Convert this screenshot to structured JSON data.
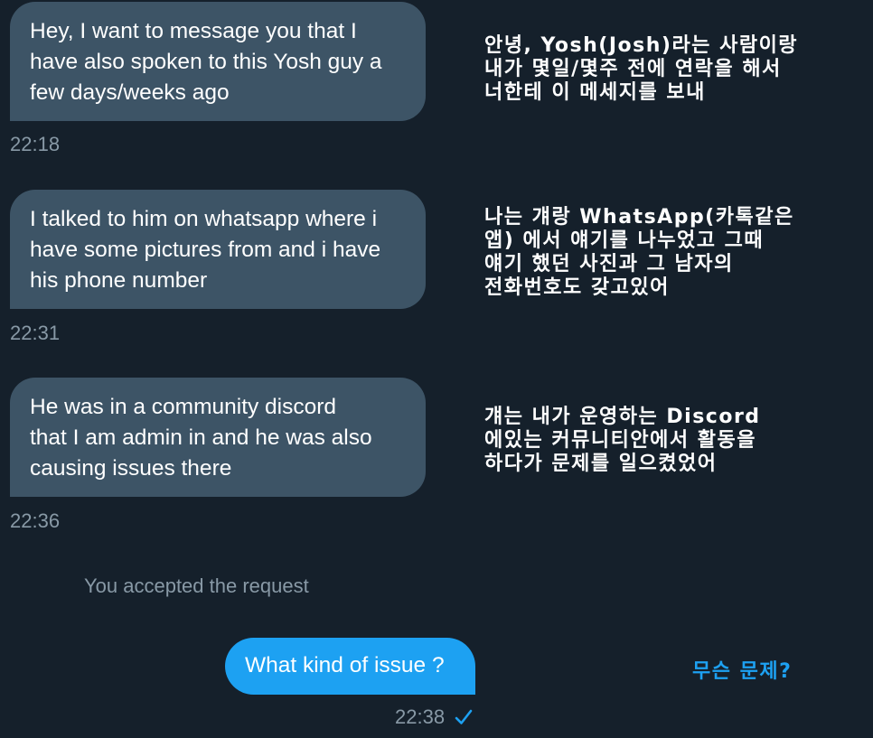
{
  "conversation": {
    "received": [
      {
        "text": "Hey, I want to message you that I\nhave also spoken to this Yosh guy a\nfew days/weeks ago",
        "time": "22:18",
        "translation": "안녕, Yosh(Josh)라는 사람이랑\n내가 몇일/몇주 전에 연락을 해서\n너한테 이 메세지를 보내"
      },
      {
        "text": "I talked to him on whatsapp where i\nhave some pictures from and i have\nhis phone number",
        "time": "22:31",
        "translation": "나는 걔랑 WhatsApp(카톡같은\n앱) 에서 얘기를 나누었고 그때\n얘기 했던 사진과 그 남자의\n전화번호도 갖고있어"
      },
      {
        "text": "He was in a community discord\nthat I am admin in and he was also\ncausing issues there",
        "time": "22:36",
        "translation": "걔는 내가 운영하는 Discord\n에있는 커뮤니티안에서 활동을\n하다가 문제를 일으켰었어"
      }
    ],
    "system_message": "You accepted the request",
    "sent": {
      "text": "What kind of issue ?",
      "time": "22:38",
      "status_icon": "checkmark-icon",
      "translation": "무슨 문제?"
    }
  },
  "colors": {
    "background": "#15202b",
    "received_bubble": "#3d5466",
    "sent_bubble": "#1da1f2",
    "timestamp": "#8899a6",
    "accent": "#1da1f2"
  }
}
